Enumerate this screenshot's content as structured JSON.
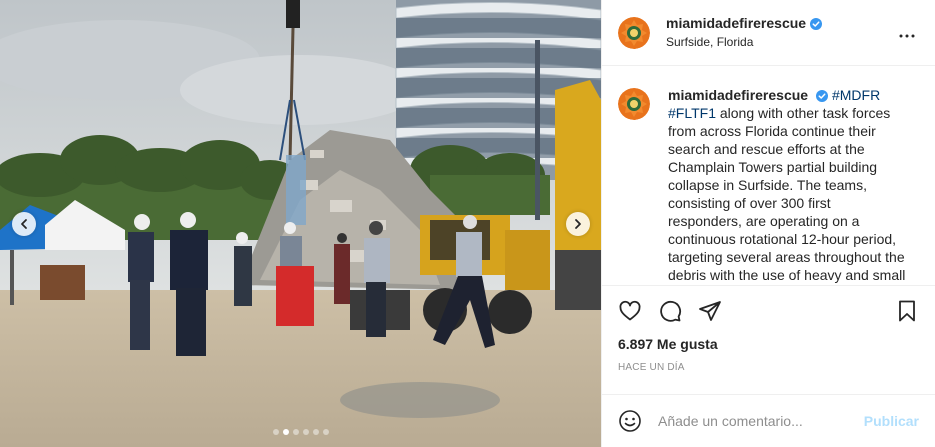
{
  "header": {
    "username": "miamidadefirerescue",
    "location": "Surfside, Florida",
    "verified_icon": "verified-badge-icon",
    "more_icon": "more-options-icon"
  },
  "caption": {
    "username": "miamidadefirerescue",
    "hashtag1": "#MDFR",
    "hashtag2": "#FLTF1",
    "body": " along with other task forces from across Florida continue their search and rescue efforts at the Champlain Towers partial building collapse in Surfside. The teams, consisting of over 300 first responders, are operating on a continuous rotational 12-hour period, targeting several areas throughout the debris with the use of heavy and small"
  },
  "actions": {
    "icons": [
      "heart-icon",
      "comment-icon",
      "share-icon",
      "bookmark-icon"
    ]
  },
  "likes": "6.897 Me gusta",
  "time_ago": "HACE UN DÍA",
  "comment": {
    "placeholder": "Añade un comentario...",
    "publish_label": "Publicar"
  },
  "carousel": {
    "slide_count": 6,
    "active_index": 1
  },
  "colors": {
    "verified_blue": "#3897f0",
    "hashtag": "#00376b",
    "publish_disabled": "#b2dffc",
    "avatar_orange": "#e8731c"
  }
}
